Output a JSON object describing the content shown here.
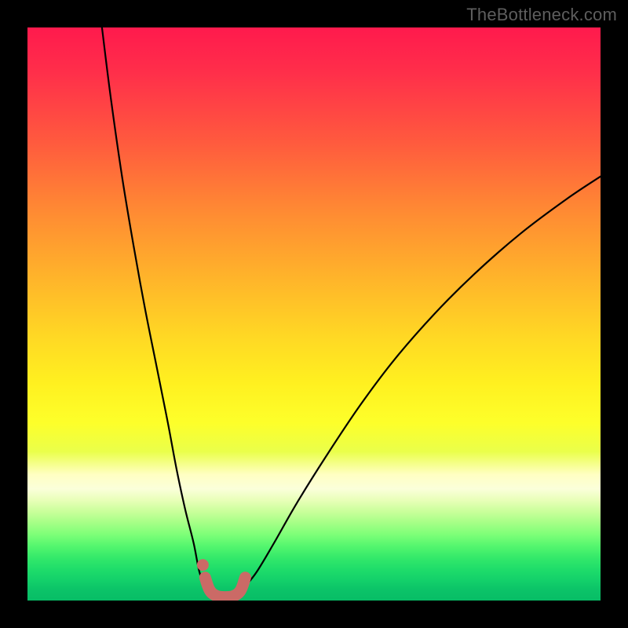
{
  "watermark": "TheBottleneck.com",
  "chart_data": {
    "type": "line",
    "title": "",
    "xlabel": "",
    "ylabel": "",
    "xlim": [
      0,
      100
    ],
    "ylim": [
      0,
      100
    ],
    "grid": false,
    "legend": false,
    "background": "rainbow-vertical-gradient",
    "note": "Bottleneck-style V-curve. Axes unlabeled in source; values are pixel-read estimates on a 0–100 normalized scale in each axis.",
    "series": [
      {
        "name": "left-branch",
        "stroke": "#000000",
        "x": [
          13.0,
          14.5,
          16.5,
          18.5,
          20.5,
          22.5,
          24.5,
          26.0,
          27.5,
          29.0,
          30.0,
          31.0
        ],
        "y": [
          100.0,
          88.0,
          74.0,
          62.0,
          51.0,
          41.0,
          31.0,
          23.0,
          16.0,
          10.0,
          5.0,
          2.5
        ]
      },
      {
        "name": "right-branch",
        "stroke": "#000000",
        "x": [
          38.0,
          40.0,
          43.0,
          47.0,
          52.0,
          58.0,
          64.0,
          71.0,
          78.0,
          86.0,
          94.0,
          100.0
        ],
        "y": [
          2.5,
          5.0,
          10.0,
          17.0,
          25.0,
          34.0,
          42.0,
          50.0,
          57.0,
          64.0,
          70.0,
          74.0
        ]
      },
      {
        "name": "valley-marker",
        "stroke": "#cb6a66",
        "type_hint": "thick rounded U marker at curve minimum",
        "x": [
          31.0,
          31.8,
          33.0,
          34.5,
          36.0,
          37.2,
          38.0
        ],
        "y": [
          4.0,
          1.8,
          0.8,
          0.6,
          0.8,
          1.8,
          4.0
        ]
      },
      {
        "name": "valley-dot",
        "stroke": "#cb6a66",
        "type_hint": "small filled circle near left top of U",
        "x": [
          30.6
        ],
        "y": [
          6.2
        ]
      }
    ]
  }
}
